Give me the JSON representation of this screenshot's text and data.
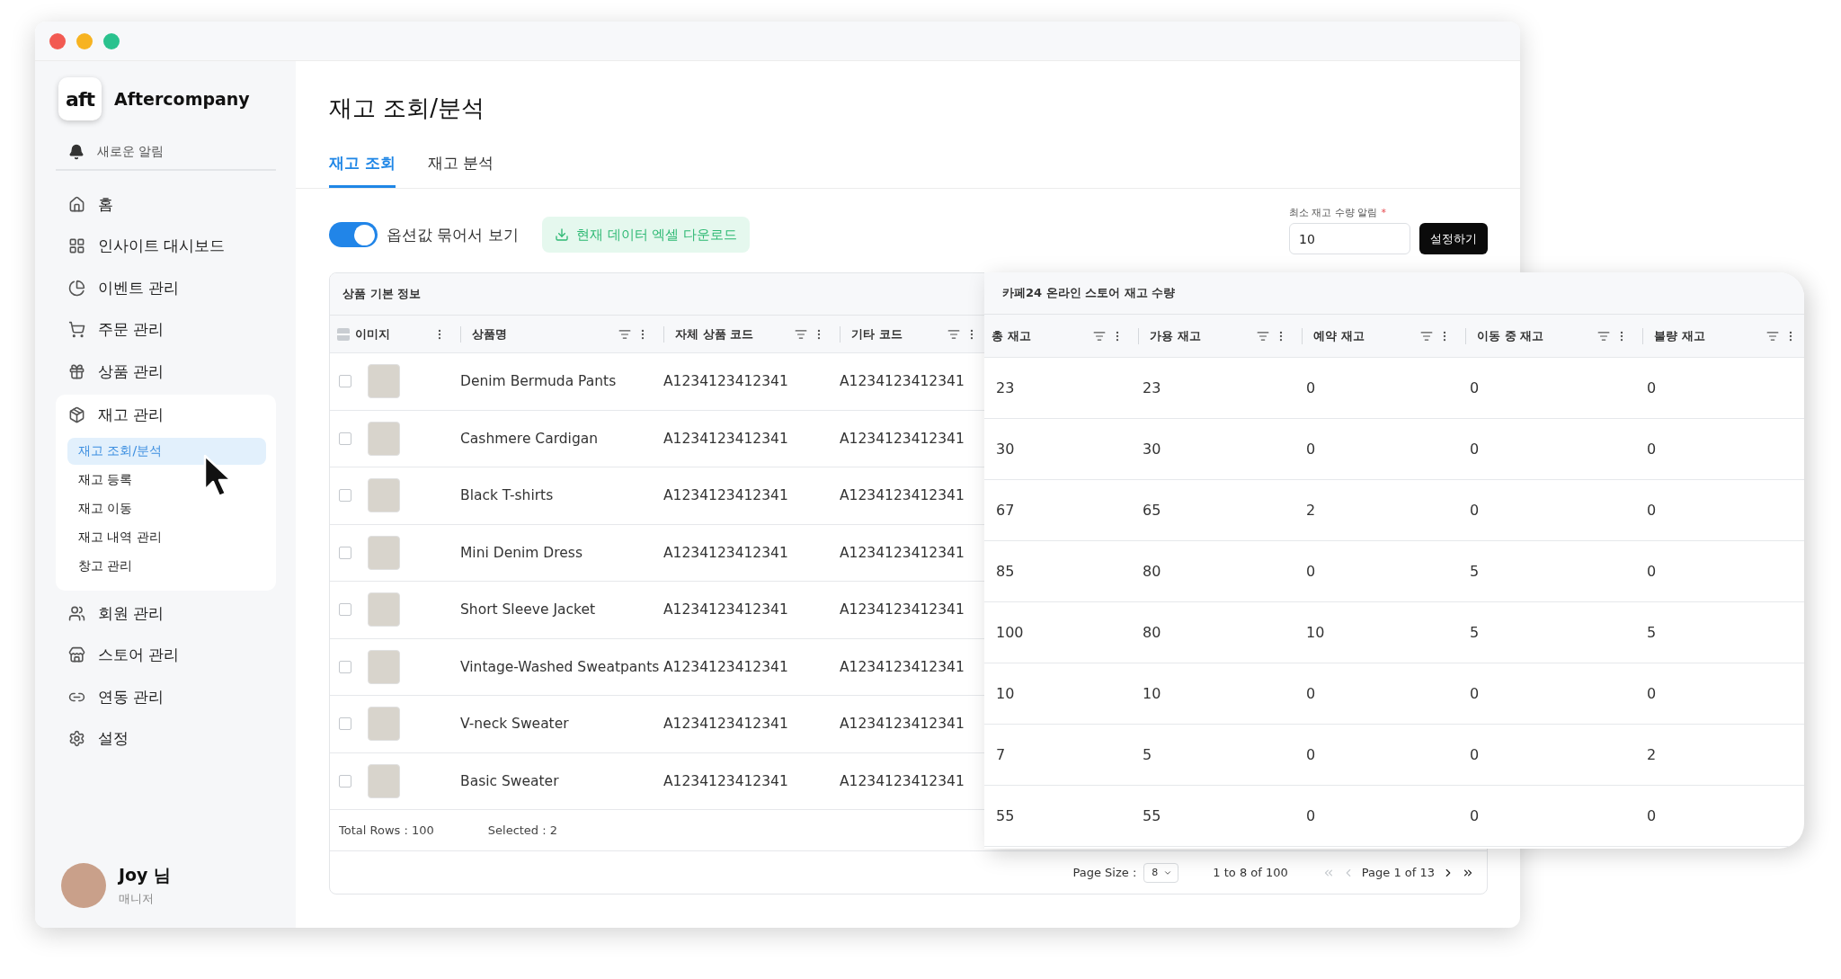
{
  "sidebar": {
    "brand": {
      "logo": "aft",
      "name": "Aftercompany"
    },
    "notifications": {
      "label": "새로운 알림"
    },
    "menu": [
      {
        "label": "홈"
      },
      {
        "label": "인사이트 대시보드"
      },
      {
        "label": "이벤트 관리"
      },
      {
        "label": "주문 관리"
      },
      {
        "label": "상품 관리"
      },
      {
        "label": "재고 관리",
        "expanded": true,
        "children": [
          {
            "label": "재고 조회/분석",
            "selected": true
          },
          {
            "label": "재고 등록",
            "selected": false
          },
          {
            "label": "재고 이동",
            "selected": false
          },
          {
            "label": "재고 내역 관리",
            "selected": false
          },
          {
            "label": "창고 관리",
            "selected": false
          }
        ]
      },
      {
        "label": "회원 관리"
      },
      {
        "label": "스토어 관리"
      },
      {
        "label": "연동 관리"
      },
      {
        "label": "설정"
      }
    ],
    "user": {
      "name": "Joy 님",
      "role": "매니저"
    }
  },
  "page_title": "재고 조회/분석",
  "tabs": [
    {
      "label": "재고 조회",
      "selected": true
    },
    {
      "label": "재고 분석",
      "selected": false
    }
  ],
  "toolbar": {
    "option_toggle": {
      "label": "옵션값 묶어서 보기",
      "on": true
    },
    "download_button": {
      "label": "현재 데이터 엑셀 다운로드"
    },
    "min_stock": {
      "label": "최소 재고 수량 알림",
      "required_mark": "*",
      "value": "10",
      "button": "설정하기"
    }
  },
  "product_table": {
    "group_title": "상품 기본 정보",
    "header_checkbox": {
      "indeterminate": true
    },
    "columns": [
      {
        "label": "이미지",
        "filterable": false
      },
      {
        "label": "상품명",
        "filterable": true
      },
      {
        "label": "자체 상품 코드",
        "filterable": true
      },
      {
        "label": "기타 코드",
        "filterable": true
      }
    ],
    "rows": [
      {
        "checked": false,
        "name": "Denim Bermuda Pants",
        "own_code": "A1234123412341",
        "other_code": "A1234123412341"
      },
      {
        "checked": false,
        "name": "Cashmere Cardigan",
        "own_code": "A1234123412341",
        "other_code": "A1234123412341"
      },
      {
        "checked": false,
        "name": "Black T-shirts",
        "own_code": "A1234123412341",
        "other_code": "A1234123412341"
      },
      {
        "checked": false,
        "name": "Mini Denim Dress",
        "own_code": "A1234123412341",
        "other_code": "A1234123412341"
      },
      {
        "checked": false,
        "name": "Short Sleeve Jacket",
        "own_code": "A1234123412341",
        "other_code": "A1234123412341"
      },
      {
        "checked": false,
        "name": "Vintage-Washed Sweatpants",
        "own_code": "A1234123412341",
        "other_code": "A1234123412341"
      },
      {
        "checked": false,
        "name": "V-neck Sweater",
        "own_code": "A1234123412341",
        "other_code": "A1234123412341"
      },
      {
        "checked": false,
        "name": "Basic Sweater",
        "own_code": "A1234123412341",
        "other_code": "A1234123412341"
      }
    ],
    "footer": {
      "total_rows": "Total Rows : 100",
      "selected": "Selected : 2"
    }
  },
  "stock_table": {
    "group_title": "카페24 온라인 스토어 재고 수량",
    "columns": [
      {
        "label": "총 재고",
        "filterable": true
      },
      {
        "label": "가용 재고",
        "filterable": true
      },
      {
        "label": "예약 재고",
        "filterable": true
      },
      {
        "label": "이동 중 재고",
        "filterable": true
      },
      {
        "label": "불량 재고",
        "filterable": true
      }
    ],
    "rows": [
      {
        "values": [
          "23",
          "23",
          "0",
          "0",
          "0"
        ]
      },
      {
        "values": [
          "30",
          "30",
          "0",
          "0",
          "0"
        ]
      },
      {
        "values": [
          "67",
          "65",
          "2",
          "0",
          "0"
        ]
      },
      {
        "values": [
          "85",
          "80",
          "0",
          "5",
          "0"
        ]
      },
      {
        "values": [
          "100",
          "80",
          "10",
          "5",
          "5"
        ]
      },
      {
        "values": [
          "10",
          "10",
          "0",
          "0",
          "0"
        ]
      },
      {
        "values": [
          "7",
          "5",
          "0",
          "0",
          "2"
        ]
      },
      {
        "values": [
          "55",
          "55",
          "0",
          "0",
          "0"
        ]
      }
    ]
  },
  "pagination": {
    "page_size_label": "Page Size :",
    "page_size": "8",
    "range": "1 to 8 of 100",
    "page": "Page 1 of 13",
    "first": {
      "disabled": true
    },
    "previous": {
      "disabled": true
    },
    "next": {
      "disabled": false
    },
    "last": {
      "disabled": false
    }
  }
}
